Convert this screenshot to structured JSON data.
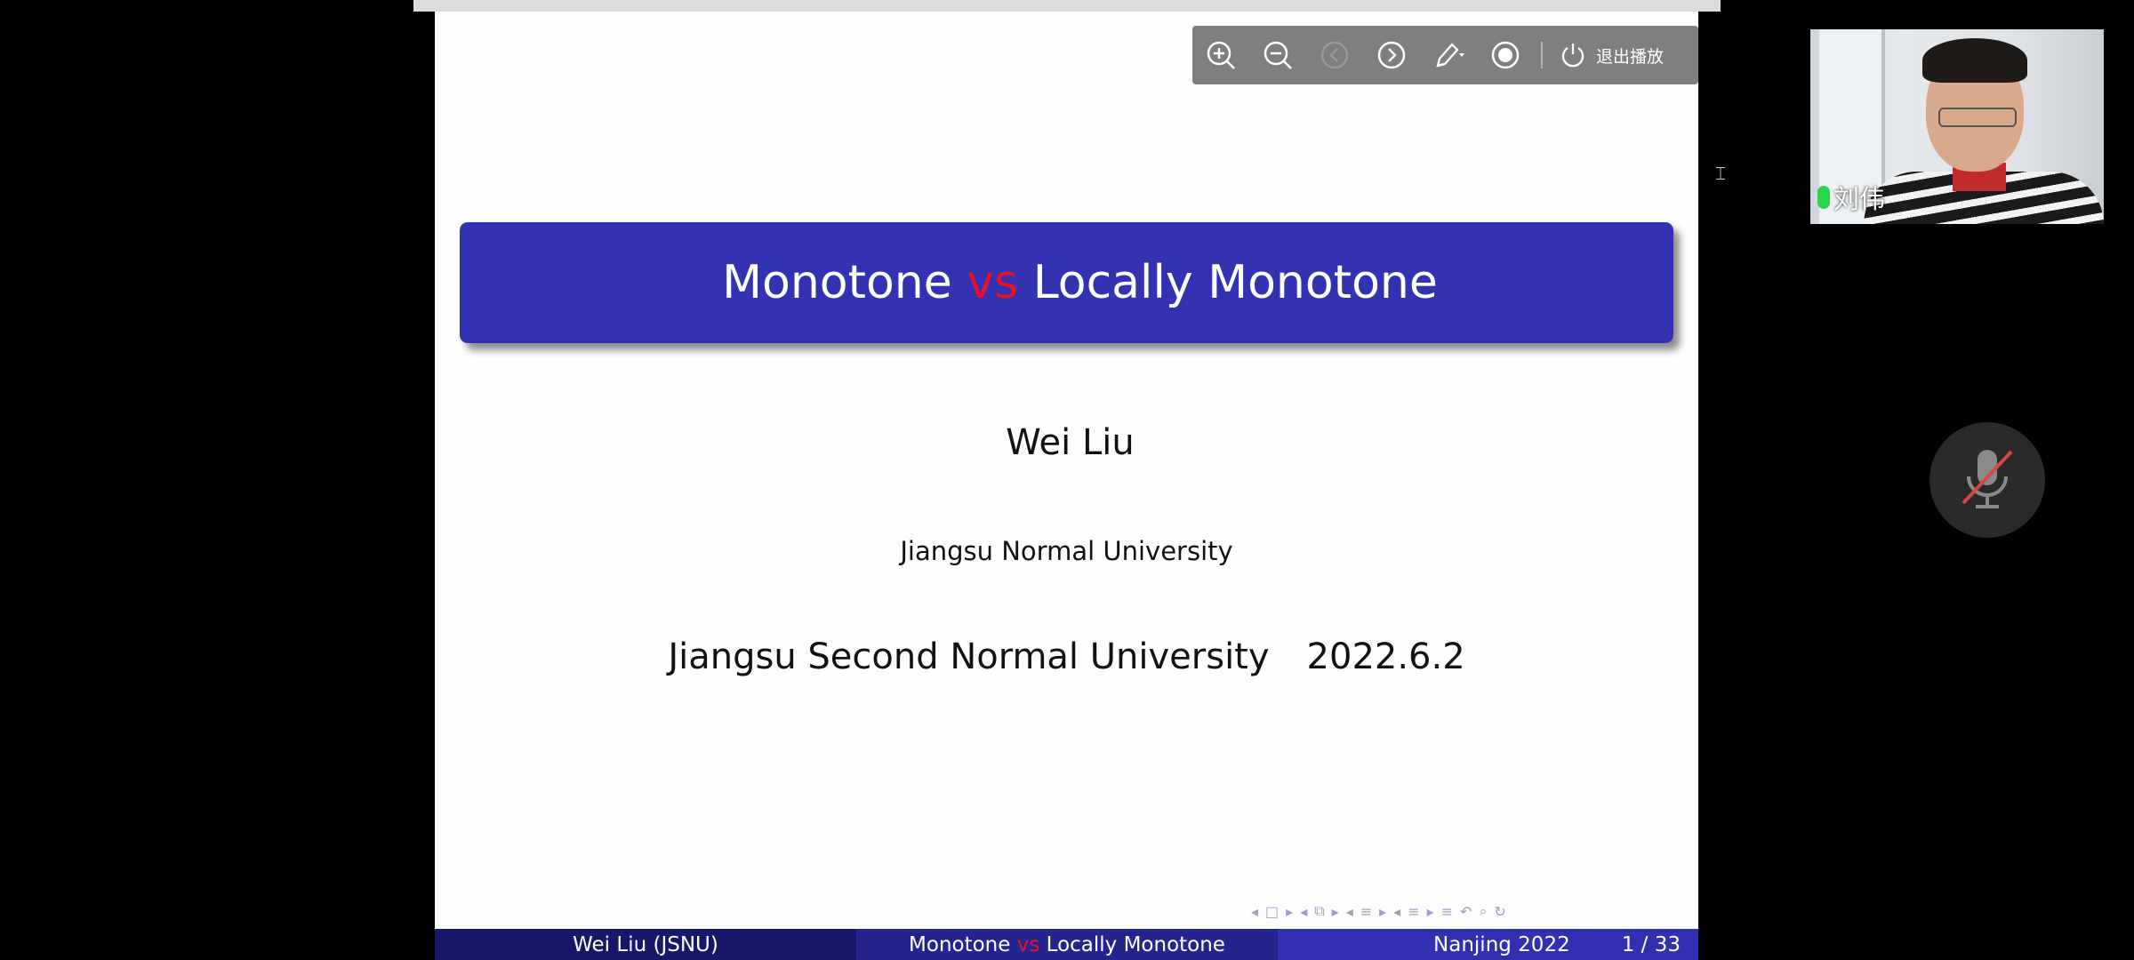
{
  "toolbar": {
    "buttons": [
      "zoom-in",
      "zoom-out",
      "previous",
      "next",
      "pen",
      "record"
    ],
    "exit_label": "退出播放"
  },
  "slide": {
    "title_part1": "Monotone",
    "title_vs": "vs",
    "title_part2": "Locally Monotone",
    "author": "Wei Liu",
    "institution": "Jiangsu Normal University",
    "venue": "Jiangsu Second Normal University",
    "date": "2022.6.2"
  },
  "footline": {
    "author_short": "Wei Liu  (JSNU)",
    "title_part1": "Monotone",
    "title_vs": "vs",
    "title_part2": "Locally Monotone",
    "location": "Nanjing  2022",
    "page": "1 / 33"
  },
  "nav_symbols": [
    "◂",
    "□",
    "▸",
    "◂",
    "⧉",
    "▸",
    "◂",
    "≡",
    "▸",
    "◂",
    "≡",
    "▸",
    "≡",
    "↶",
    "⌕",
    "↻"
  ],
  "video": {
    "participant_name": "刘伟"
  },
  "colors": {
    "beamer_blue": "#3333b2",
    "accent_red": "#e8122a",
    "toolbar_gray": "#7f7f7f",
    "mic_green": "#2bd44b"
  }
}
